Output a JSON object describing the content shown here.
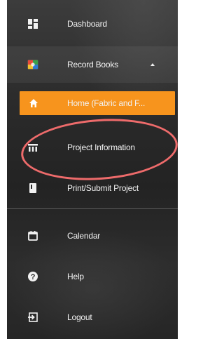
{
  "sidebar": {
    "items": [
      {
        "label": "Dashboard",
        "icon": "dashboard-icon"
      },
      {
        "label": "Record Books",
        "icon": "record-books-icon"
      },
      {
        "label": "Home (Fabric and F...",
        "icon": "home-icon"
      },
      {
        "label": "Project Information",
        "icon": "project-information-icon"
      },
      {
        "label": "Print/Submit Project",
        "icon": "book-icon"
      },
      {
        "label": "Calendar",
        "icon": "calendar-icon"
      },
      {
        "label": "Help",
        "icon": "help-icon"
      },
      {
        "label": "Logout",
        "icon": "logout-icon"
      }
    ]
  },
  "colors": {
    "active_bg": "#f7941d",
    "annotation": "#ee6b6b",
    "text": "#f2f2f2"
  }
}
